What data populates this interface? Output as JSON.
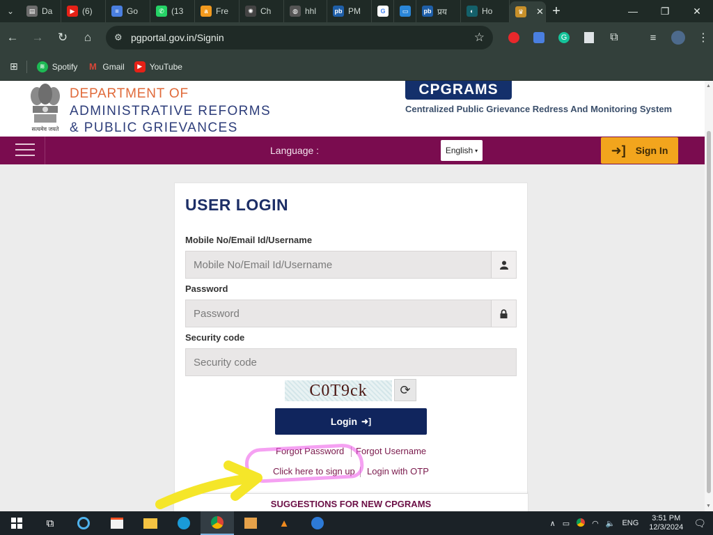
{
  "browser": {
    "tabs": [
      {
        "label": "Da",
        "favicon": "doc",
        "color": "#6d6d6d"
      },
      {
        "label": "(6)",
        "favicon": "youtube",
        "color": "#e62117"
      },
      {
        "label": "Go",
        "favicon": "docs",
        "color": "#4a7fe0"
      },
      {
        "label": "(13",
        "favicon": "whatsapp",
        "color": "#25d366"
      },
      {
        "label": "Fre",
        "favicon": "amazon",
        "color": "#f29a1e"
      },
      {
        "label": "Ch",
        "favicon": "chatgpt",
        "color": "#444444"
      },
      {
        "label": "hhl",
        "favicon": "globe",
        "color": "#555555"
      },
      {
        "label": "PM",
        "favicon": "pb",
        "color": "#1f5fa8"
      },
      {
        "label": "",
        "favicon": "google",
        "color": "#ffffff"
      },
      {
        "label": "",
        "favicon": "screen",
        "color": "#2a86d8"
      },
      {
        "label": "प्रय",
        "favicon": "pb",
        "color": "#1f5fa8"
      },
      {
        "label": "Ho",
        "favicon": "teal",
        "color": "#14606a"
      },
      {
        "label": "",
        "favicon": "emblem",
        "color": "#c8902a",
        "active": true
      }
    ],
    "url": "pgportal.gov.in/Signin",
    "bookmarks": [
      {
        "label": "Spotify",
        "color": "#1db954"
      },
      {
        "label": "Gmail",
        "color": "#d44638"
      },
      {
        "label": "YouTube",
        "color": "#e62117"
      }
    ]
  },
  "header": {
    "dept_line1": "DEPARTMENT OF",
    "dept_line2": "ADMINISTRATIVE REFORMS",
    "dept_line3": "& PUBLIC GRIEVANCES",
    "emblem_motto": "सत्यमेव जयते",
    "cpgrams": "CPGRAMS",
    "cpgrams_full": "Centralized Public Grievance Redress And Monitoring System"
  },
  "navband": {
    "language_label": "Language :",
    "language_value": "English",
    "signin_label": "Sign In"
  },
  "login": {
    "title": "USER LOGIN",
    "username_label": "Mobile No/Email Id/Username",
    "username_placeholder": "Mobile No/Email Id/Username",
    "password_label": "Password",
    "password_placeholder": "Password",
    "security_label": "Security code",
    "security_placeholder": "Security code",
    "captcha_text": "C0T9ck",
    "login_button": "Login",
    "forgot_password": "Forgot Password",
    "forgot_username": "Forgot Username",
    "signup": "Click here to sign up",
    "otp": "Login with OTP"
  },
  "suggestions": "SUGGESTIONS FOR NEW CPGRAMS",
  "taskbar": {
    "language": "ENG",
    "time": "3:51 PM",
    "date": "12/3/2024"
  }
}
